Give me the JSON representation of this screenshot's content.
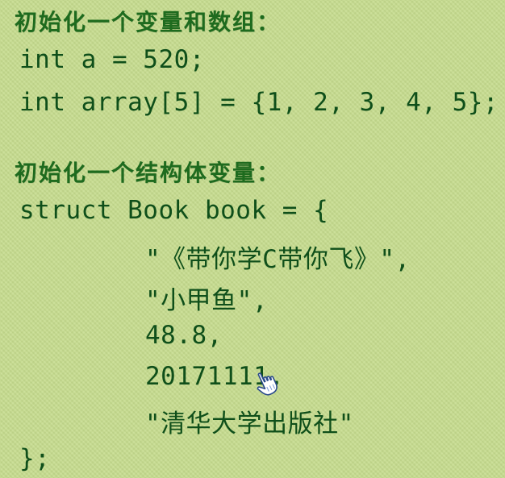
{
  "section1": {
    "heading": "初始化一个变量和数组：",
    "line1": "int a = 520;",
    "line2": "int array[5] = {1, 2, 3, 4, 5};"
  },
  "section2": {
    "heading": "初始化一个结构体变量：",
    "open": "struct Book book = {",
    "fields": [
      "\"《带你学C带你飞》\",",
      "\"小甲鱼\",",
      "48.8,",
      "20171111,",
      "\"清华大学出版社\""
    ],
    "close": "};"
  },
  "cursor_icon": "hand-pointer-icon"
}
